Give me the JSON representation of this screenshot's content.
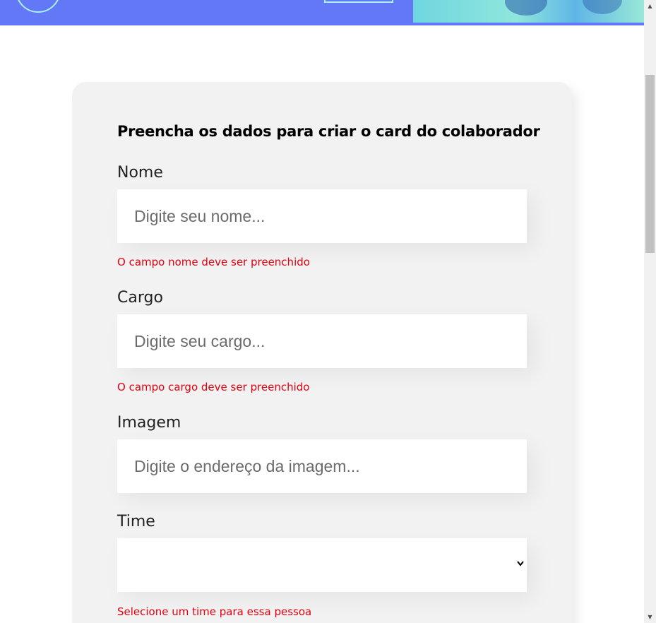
{
  "form": {
    "title": "Preencha os dados para criar o card do colaborador",
    "fields": [
      {
        "label": "Nome",
        "placeholder": "Digite seu nome...",
        "value": "",
        "error": "O campo nome deve ser preenchido"
      },
      {
        "label": "Cargo",
        "placeholder": "Digite seu cargo...",
        "value": "",
        "error": "O campo cargo deve ser preenchido"
      },
      {
        "label": "Imagem",
        "placeholder": "Digite o endereço da imagem...",
        "value": ""
      },
      {
        "label": "Time",
        "selected": "",
        "error": "Selecione um time para essa pessoa"
      }
    ]
  },
  "colors": {
    "banner": "#6278f7",
    "error": "#e3000f",
    "card": "#f2f2f2"
  },
  "icons": {
    "select": "chevron-down-icon",
    "scroll_up": "triangle-up-icon",
    "scroll_down": "triangle-down-icon"
  }
}
